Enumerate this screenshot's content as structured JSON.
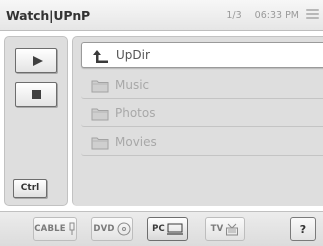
{
  "header": {
    "title": "Watch|UPnP",
    "page_indicator": "1/3",
    "clock": "06:33 PM"
  },
  "left_panel": {
    "ctrl_label": "Ctrl"
  },
  "file_list": {
    "items": [
      {
        "label": "UpDir",
        "icon": "updir-arrow-icon",
        "selected": true
      },
      {
        "label": "Music",
        "icon": "folder-icon",
        "selected": false
      },
      {
        "label": "Photos",
        "icon": "folder-icon",
        "selected": false
      },
      {
        "label": "Movies",
        "icon": "folder-icon",
        "selected": false
      }
    ]
  },
  "sources": {
    "cable_label": "CABLE",
    "dvd_label": "DVD",
    "pc_label": "PC",
    "tv_label": "TV",
    "help_label": "?",
    "active": "PC"
  }
}
